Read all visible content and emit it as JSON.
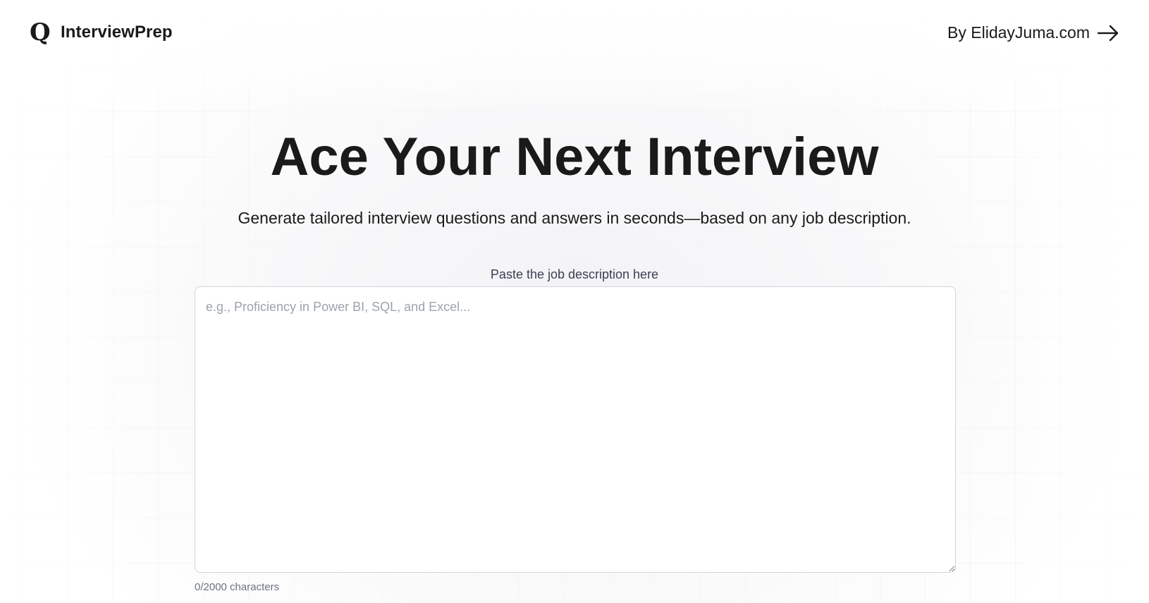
{
  "header": {
    "brand_icon": "Q",
    "brand_name": "InterviewPrep",
    "author_link_label": "By ElidayJuma.com",
    "author_link_icon": "arrow-right-icon"
  },
  "hero": {
    "title": "Ace Your Next Interview",
    "subtitle": "Generate tailored interview questions and answers in seconds—based on any job description."
  },
  "job_form": {
    "label": "Paste the job description here",
    "placeholder": "e.g., Proficiency in Power BI, SQL, and Excel...",
    "value": "",
    "char_counter": "0/2000 characters"
  }
}
